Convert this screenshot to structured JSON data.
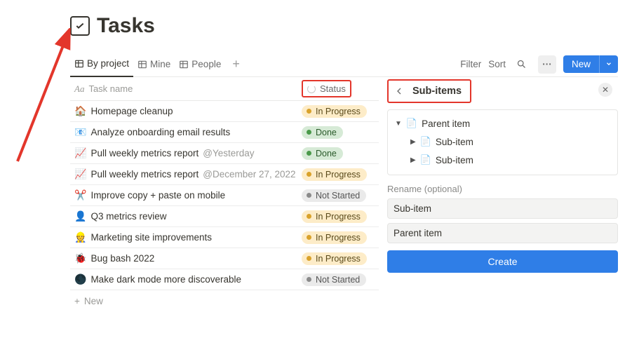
{
  "page": {
    "title": "Tasks",
    "icon": "checkbox-icon"
  },
  "views": {
    "tabs": [
      {
        "label": "By project",
        "active": true
      },
      {
        "label": "Mine",
        "active": false
      },
      {
        "label": "People",
        "active": false
      }
    ]
  },
  "toolbar": {
    "filter": "Filter",
    "sort": "Sort",
    "new_label": "New"
  },
  "columns": {
    "name": {
      "label": "Task name",
      "type_prefix": "Aa"
    },
    "status": {
      "label": "Status"
    }
  },
  "status_styles": {
    "In Progress": "inprogress",
    "Done": "done",
    "Not Started": "notstarted"
  },
  "rows": [
    {
      "emoji": "🏠",
      "name": "Homepage cleanup",
      "suffix": "",
      "status": "In Progress"
    },
    {
      "emoji": "📧",
      "name": "Analyze onboarding email results",
      "suffix": "",
      "status": "Done"
    },
    {
      "emoji": "📈",
      "name": "Pull weekly metrics report",
      "suffix": "@Yesterday",
      "status": "Done"
    },
    {
      "emoji": "📈",
      "name": "Pull weekly metrics report",
      "suffix": "@December 27, 2022",
      "status": "In Progress"
    },
    {
      "emoji": "✂️",
      "name": "Improve copy + paste on mobile",
      "suffix": "",
      "status": "Not Started"
    },
    {
      "emoji": "👤",
      "name": "Q3 metrics review",
      "suffix": "",
      "status": "In Progress"
    },
    {
      "emoji": "👷",
      "name": "Marketing site improvements",
      "suffix": "",
      "status": "In Progress"
    },
    {
      "emoji": "🐞",
      "name": "Bug bash 2022",
      "suffix": "",
      "status": "In Progress"
    },
    {
      "emoji": "🌑",
      "name": "Make dark mode more discoverable",
      "suffix": "",
      "status": "Not Started"
    }
  ],
  "new_row_label": "New",
  "panel": {
    "title": "Sub-items",
    "tree": {
      "parent": {
        "emoji": "📄",
        "label": "Parent item"
      },
      "children": [
        {
          "emoji": "📄",
          "label": "Sub-item"
        },
        {
          "emoji": "📄",
          "label": "Sub-item"
        }
      ]
    },
    "rename_label": "Rename (optional)",
    "input_subitem": "Sub-item",
    "input_parent": "Parent item",
    "create_label": "Create"
  }
}
